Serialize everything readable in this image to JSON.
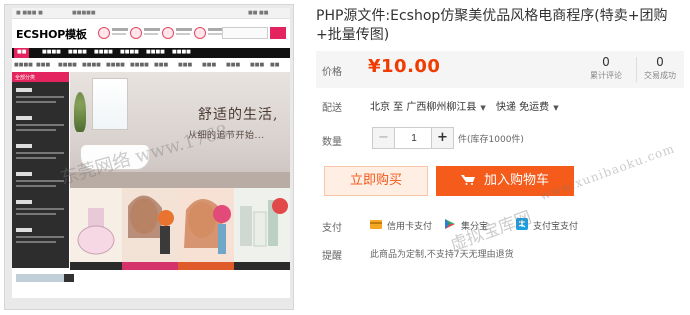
{
  "thumbnail": {
    "logo": "ECSHOP模板",
    "slogan_line1": "舒适的生活,",
    "slogan_line2": "从细的追节开始...",
    "watermark": "东莞网络 www.1768...",
    "side_header": "全部分类",
    "brands": [
      "REVLON",
      "CLINIQUE"
    ],
    "sale_badge": "3.2折"
  },
  "product": {
    "title": "PHP源文件:Ecshop仿聚美优品风格电商程序(特卖+团购+批量传图)",
    "price_label": "价格",
    "price": "¥10.00",
    "stats": [
      {
        "value": "0",
        "label": "累计评论"
      },
      {
        "value": "0",
        "label": "交易成功"
      }
    ],
    "shipping": {
      "label": "配送",
      "location": "北京 至  广西柳州柳江县",
      "type": "快递 免运费"
    },
    "quantity": {
      "label": "数量",
      "value": "1",
      "minus": "−",
      "plus": "+",
      "stock_text": "件(库存1000件)"
    },
    "buy_now": "立即购买",
    "add_to_cart": "加入购物车",
    "payment": {
      "label": "支付",
      "methods": [
        {
          "name": "信用卡支付",
          "icon": "credit-card-icon"
        },
        {
          "name": "集分宝",
          "icon": "jifenbao-icon"
        },
        {
          "name": "支付宝支付",
          "icon": "alipay-icon"
        }
      ]
    },
    "tips": {
      "label": "提醒",
      "text": "此商品为定制,不支持7天无理由退货"
    }
  },
  "watermarks": {
    "right": "www.xunibaoku.com",
    "site": "虚拟宝库网"
  },
  "colors": {
    "accent": "#f55b1a",
    "price": "#f03c00",
    "brand_pink": "#e4245f"
  }
}
